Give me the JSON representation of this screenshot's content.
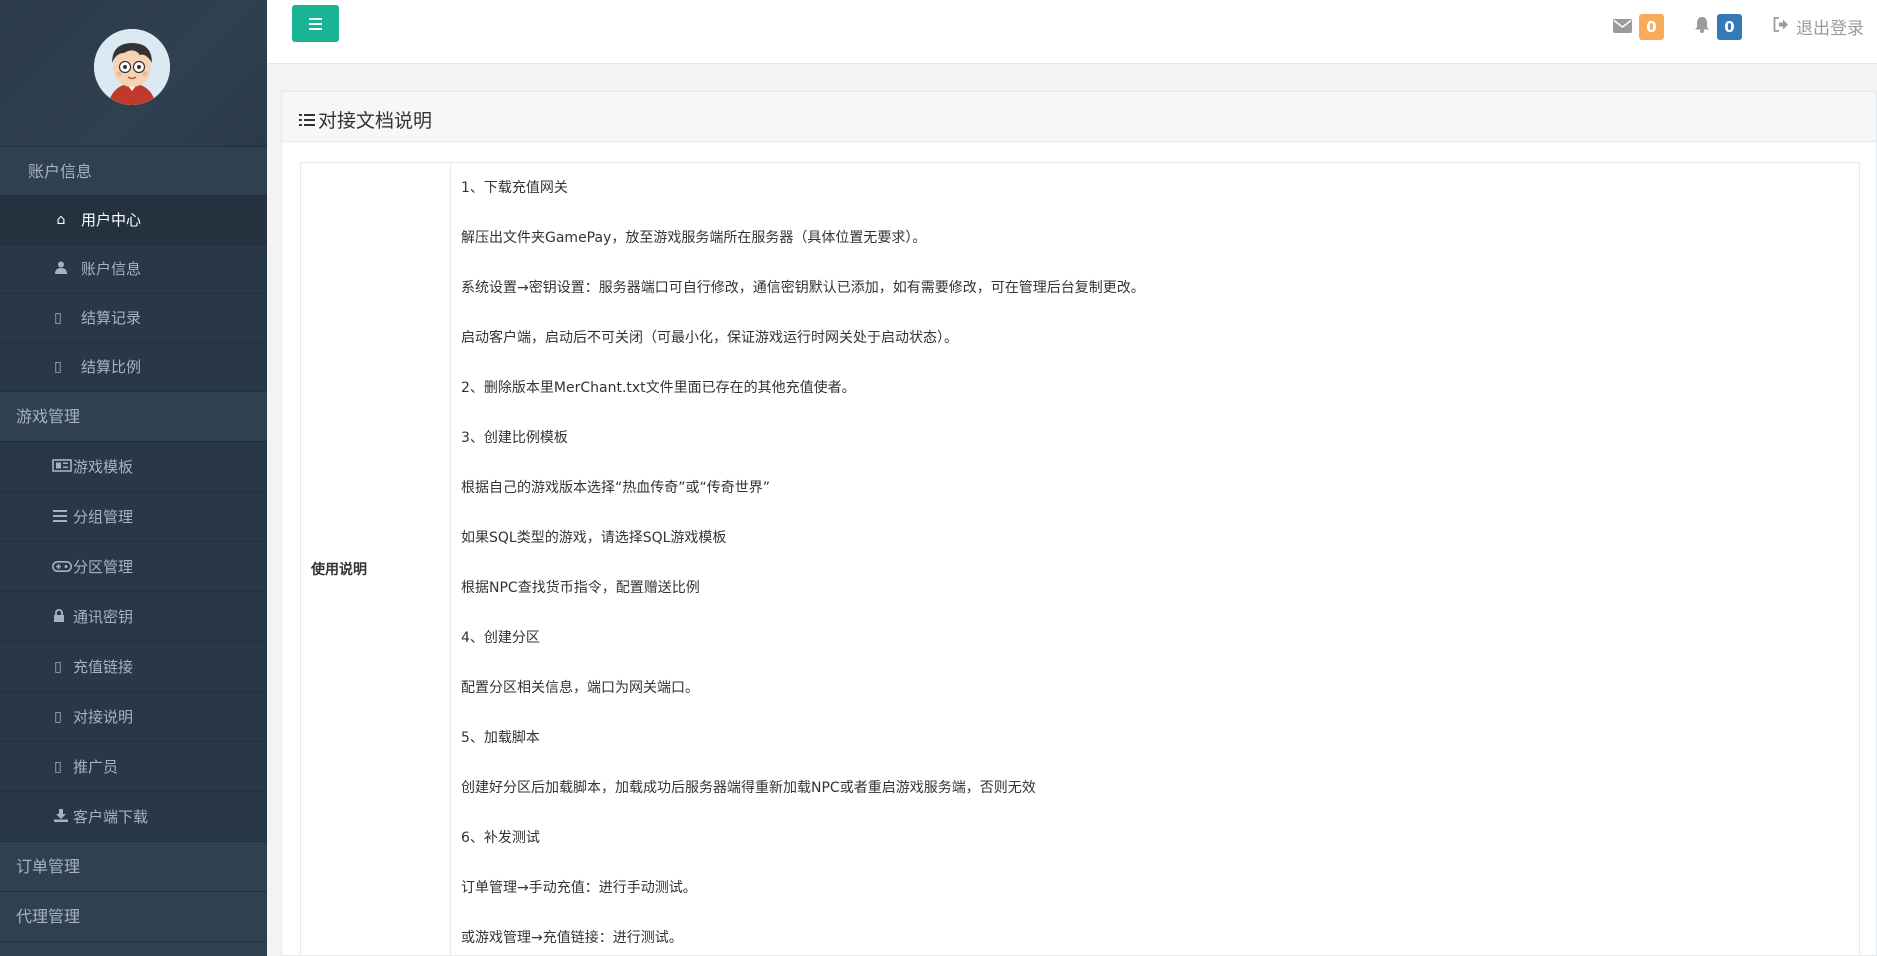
{
  "sidebar": {
    "heads": {
      "account": "账户信息",
      "games": "游戏管理",
      "orders": "订单管理",
      "agents": "代理管理"
    },
    "account_items": [
      {
        "label": "用户中心",
        "icon": "home-icon"
      },
      {
        "label": "账户信息",
        "icon": "user-icon"
      },
      {
        "label": "结算记录",
        "icon": "file-icon"
      },
      {
        "label": "结算比例",
        "icon": "file-icon"
      }
    ],
    "game_items": [
      {
        "label": "游戏模板",
        "icon": "newspaper-icon"
      },
      {
        "label": "分组管理",
        "icon": "bars-icon"
      },
      {
        "label": "分区管理",
        "icon": "gamepad-icon"
      },
      {
        "label": "通讯密钥",
        "icon": "lock-icon"
      },
      {
        "label": "充值链接",
        "icon": "file-icon"
      },
      {
        "label": "对接说明",
        "icon": "file-icon"
      },
      {
        "label": "推广员",
        "icon": "file-icon"
      },
      {
        "label": "客户端下载",
        "icon": "download-icon"
      }
    ]
  },
  "topbar": {
    "messages_count": "0",
    "notifications_count": "0",
    "logout_label": "退出登录"
  },
  "panel": {
    "title": "对接文档说明",
    "row_label": "使用说明",
    "lines": [
      "1、下载充值网关",
      "解压出文件夹GamePay，放至游戏服务端所在服务器（具体位置无要求）。",
      "系统设置→密钥设置：服务器端口可自行修改，通信密钥默认已添加，如有需要修改，可在管理后台复制更改。",
      "启动客户端，启动后不可关闭（可最小化，保证游戏运行时网关处于启动状态）。",
      "2、删除版本里MerChant.txt文件里面已存在的其他充值使者。",
      "3、创建比例模板",
      "根据自己的游戏版本选择“热血传奇”或“传奇世界”",
      "如果SQL类型的游戏，请选择SQL游戏模板",
      "根据NPC查找货币指令，配置赠送比例",
      "4、创建分区",
      "配置分区相关信息，端口为网关端口。",
      "5、加载脚本",
      "创建好分区后加载脚本，加载成功后服务器端得重新加载NPC或者重启游戏服务端，否则无效",
      "6、补发测试",
      "订单管理→手动充值：进行手动测试。",
      "或游戏管理→充值链接：进行测试。"
    ]
  }
}
